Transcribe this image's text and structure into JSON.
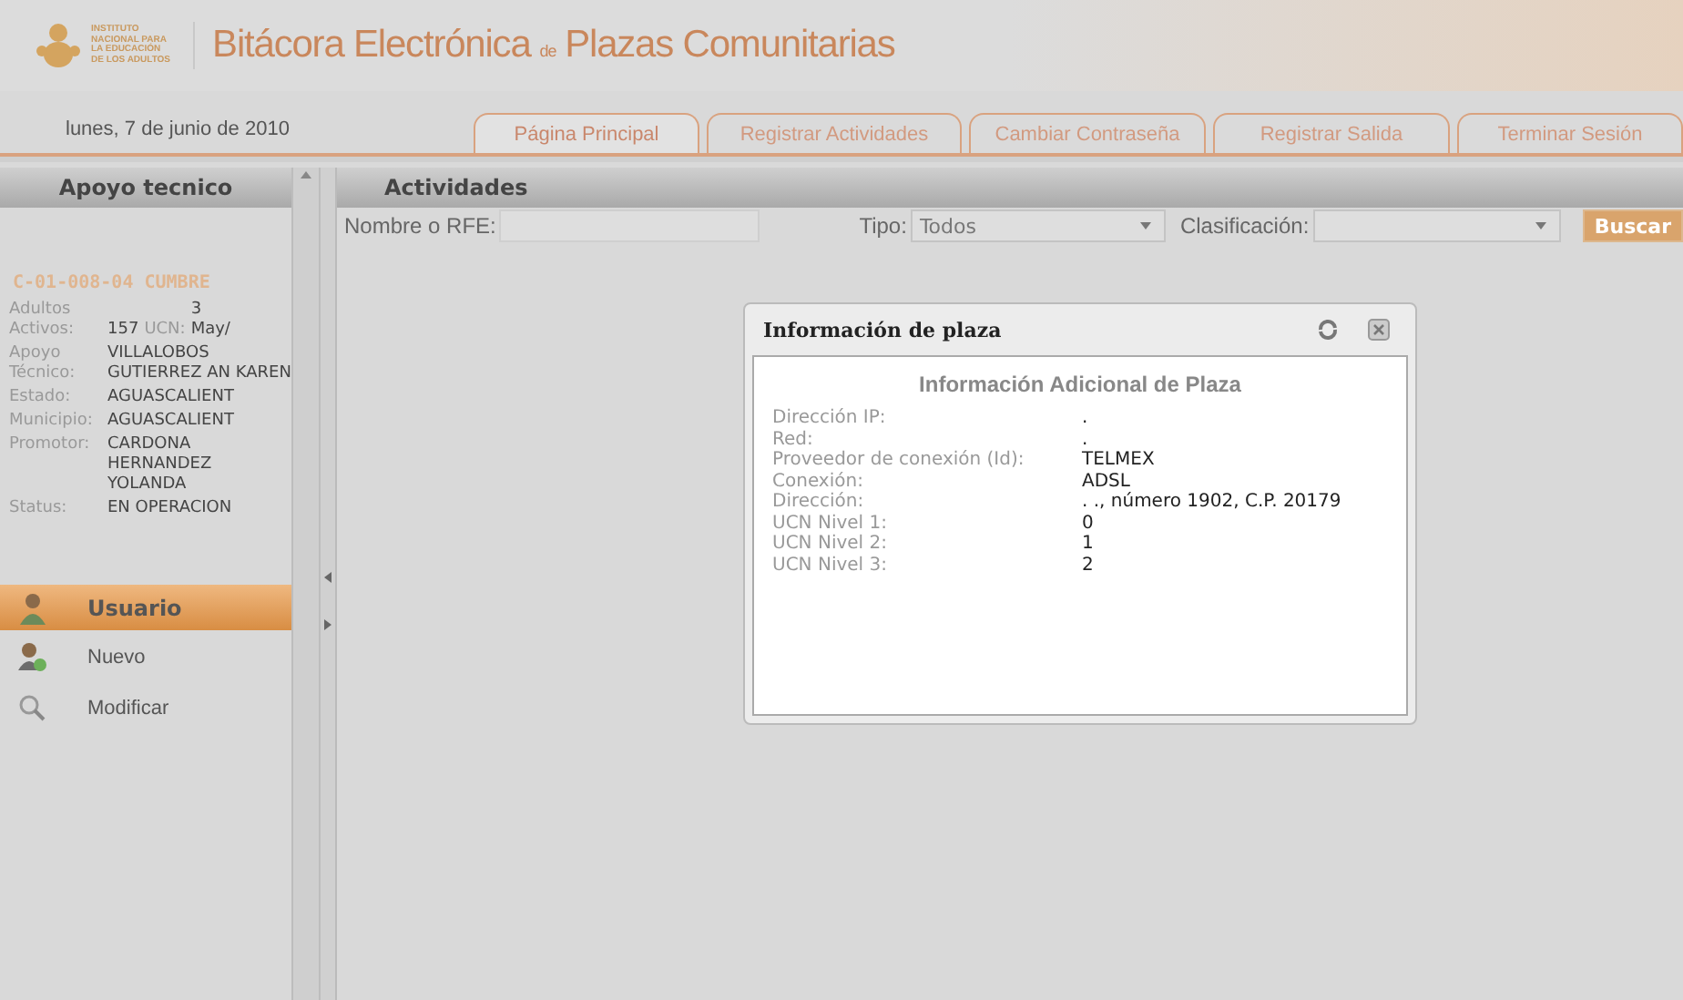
{
  "header": {
    "logo_lines": [
      "INSTITUTO",
      "NACIONAL PARA",
      "LA EDUCACIÓN",
      "DE LOS ADULTOS"
    ],
    "title_start": "Bitácora Electrónica",
    "title_small": "de",
    "title_end": "Plazas Comunitarias"
  },
  "date": "lunes, 7 de junio de 2010",
  "tabs": [
    {
      "label": "Página Principal",
      "selected": true
    },
    {
      "label": "Registrar Actividades",
      "selected": false
    },
    {
      "label": "Cambiar Contraseña",
      "selected": false
    },
    {
      "label": "Registrar Salida",
      "selected": false
    },
    {
      "label": "Terminar Sesión",
      "selected": false
    }
  ],
  "sidebar": {
    "title": "Apoyo tecnico",
    "plaza_code": "C-01-008-04 CUMBRE",
    "fields": [
      {
        "label": "Adultos Activos:",
        "value": "157",
        "extra_label": "UCN:",
        "extra_value": "3 May/"
      },
      {
        "label": "Apoyo Técnico:",
        "value": "VILLALOBOS GUTIERREZ AN KAREN"
      },
      {
        "label": "Estado:",
        "value": "AGUASCALIENT"
      },
      {
        "label": "Municipio:",
        "value": "AGUASCALIENT"
      },
      {
        "label": "Promotor:",
        "value": "CARDONA HERNANDEZ YOLANDA"
      },
      {
        "label": "Status:",
        "value": "EN OPERACION"
      }
    ],
    "menu_title": "Usuario",
    "menu_items": [
      {
        "label": "Nuevo",
        "kind": "new"
      },
      {
        "label": "Modificar",
        "kind": "search"
      }
    ]
  },
  "main": {
    "title": "Actividades",
    "filters": {
      "name_label": "Nombre o RFE:",
      "type_label": "Tipo:",
      "type_value": "Todos",
      "class_label": "Clasificación:",
      "search_button": "Buscar"
    }
  },
  "dialog": {
    "title": "Información de plaza",
    "heading": "Información Adicional de Plaza",
    "rows": [
      {
        "label": "Dirección IP:",
        "value": "."
      },
      {
        "label": "Red:",
        "value": "."
      },
      {
        "label": "Proveedor de conexión (Id):",
        "value": "TELMEX"
      },
      {
        "label": "Conexión:",
        "value": "ADSL"
      },
      {
        "label": "Dirección:",
        "value": ". ., número 1902, C.P. 20179"
      },
      {
        "label": "UCN Nivel 1:",
        "value": "0"
      },
      {
        "label": "UCN Nivel 2:",
        "value": "1"
      },
      {
        "label": "UCN Nivel 3:",
        "value": "2"
      }
    ]
  }
}
